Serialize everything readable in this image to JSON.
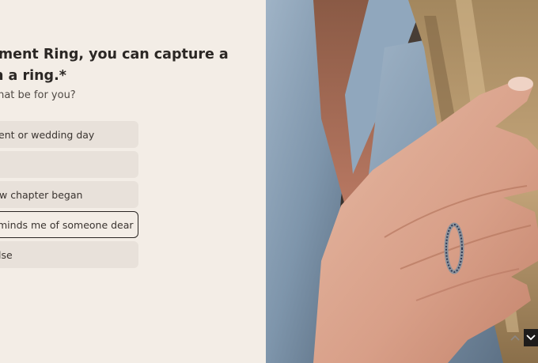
{
  "question": {
    "line1": "ement Ring, you can capture a",
    "line2": "in a ring.*",
    "subtext": "that be for you?"
  },
  "options": [
    {
      "label": "ent or wedding day",
      "selected": false
    },
    {
      "label": "",
      "selected": false
    },
    {
      "label": "w chapter began",
      "selected": false
    },
    {
      "label": "minds me of someone dear",
      "selected": true
    },
    {
      "label": "lse",
      "selected": false
    }
  ],
  "navigation": {
    "up_icon": "chevron-up-icon",
    "down_icon": "chevron-down-icon"
  },
  "colors": {
    "background": "#f3ede6",
    "option_bg": "#e8e1da",
    "text": "#2a2623",
    "nav_bg": "#1e1c1b"
  }
}
